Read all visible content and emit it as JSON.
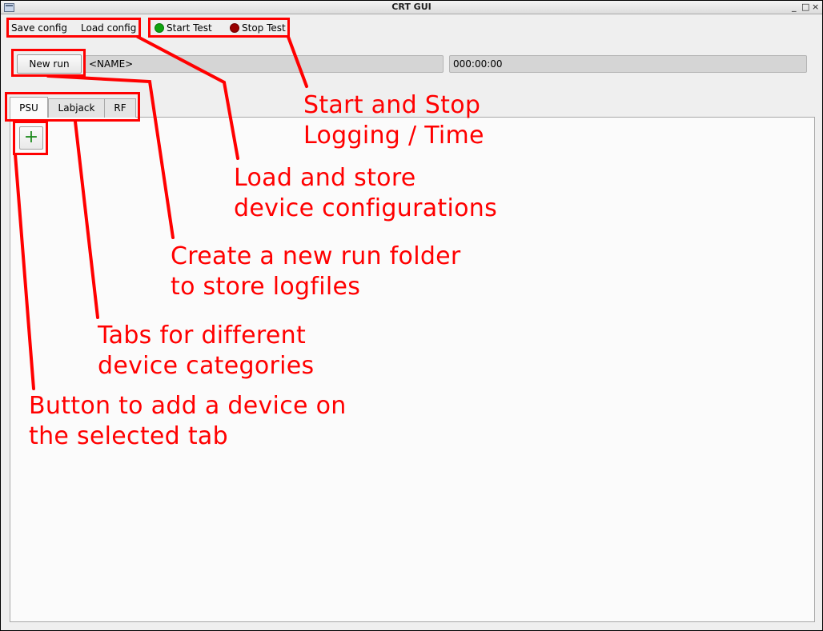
{
  "window": {
    "title": "CRT GUI",
    "controls": [
      "_",
      "□",
      "×"
    ]
  },
  "toolbar": {
    "save_config_label": "Save config",
    "load_config_label": "Load config",
    "start_test_label": "Start Test",
    "stop_test_label": "Stop Test",
    "start_color": "#0fa30f",
    "stop_color": "#990000"
  },
  "run": {
    "new_run_label": "New run",
    "name_value": "<NAME>",
    "time_value": "000:00:00"
  },
  "tabs": [
    {
      "label": "PSU",
      "active": true
    },
    {
      "label": "Labjack",
      "active": false
    },
    {
      "label": "RF",
      "active": false
    }
  ],
  "add_device_button": {
    "icon": "plus-icon",
    "glyph": "+"
  },
  "annotations": {
    "color": "#ff0000",
    "callouts": [
      {
        "line1": "Start and Stop",
        "line2": "Logging / Time"
      },
      {
        "line1": "Load and store",
        "line2": "device configurations"
      },
      {
        "line1": "Create a new run folder",
        "line2": "to store logfiles"
      },
      {
        "line1": "Tabs for different",
        "line2": "device categories"
      },
      {
        "line1": "Button to add a device on",
        "line2": "the selected tab"
      }
    ]
  }
}
